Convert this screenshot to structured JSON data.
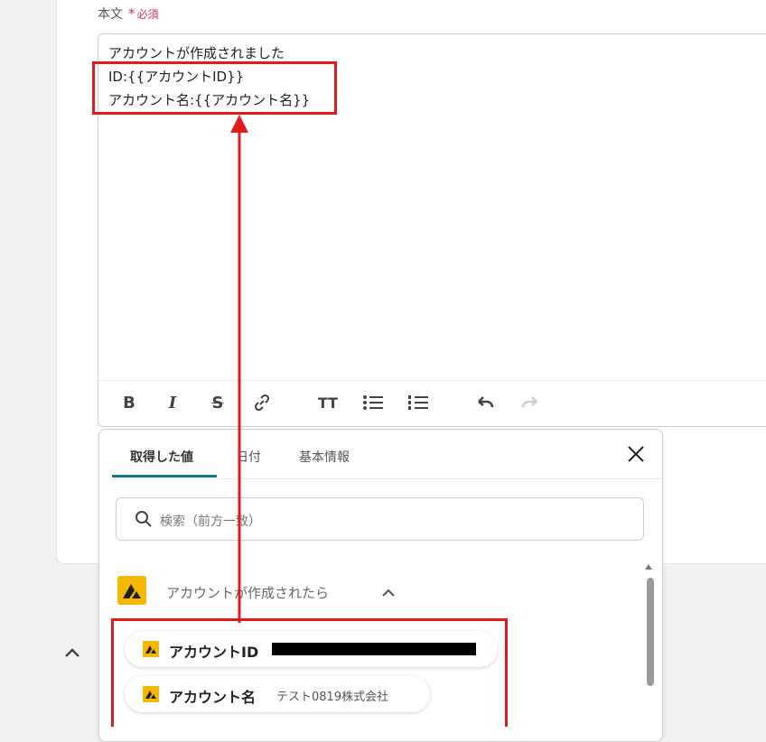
{
  "field": {
    "label": "本文",
    "required_mark": "*",
    "required_text": "必須"
  },
  "editor": {
    "lines": [
      "アカウントが作成されました",
      "ID:{{アカウントID}}",
      "アカウント名:{{アカウント名}}"
    ]
  },
  "toolbar": {
    "buttons": [
      "bold-icon",
      "italic-icon",
      "strikethrough-icon",
      "link-icon",
      "text-size-icon",
      "bullet-list-icon",
      "numbered-list-icon",
      "undo-icon",
      "redo-icon"
    ]
  },
  "popup": {
    "tabs": [
      {
        "label": "取得した値"
      },
      {
        "label": "日付"
      },
      {
        "label": "基本情報"
      }
    ],
    "search_placeholder": "検索（前方一致）",
    "group": {
      "title": "アカウントが作成されたら"
    },
    "items": [
      {
        "name": "アカウントID",
        "value": ""
      },
      {
        "name": "アカウント名",
        "value": "テスト0819株式会社"
      }
    ]
  },
  "colors": {
    "accent": "#127a86",
    "highlight": "#e11b1b",
    "brand": "#f5b800",
    "required": "#e0305a"
  }
}
